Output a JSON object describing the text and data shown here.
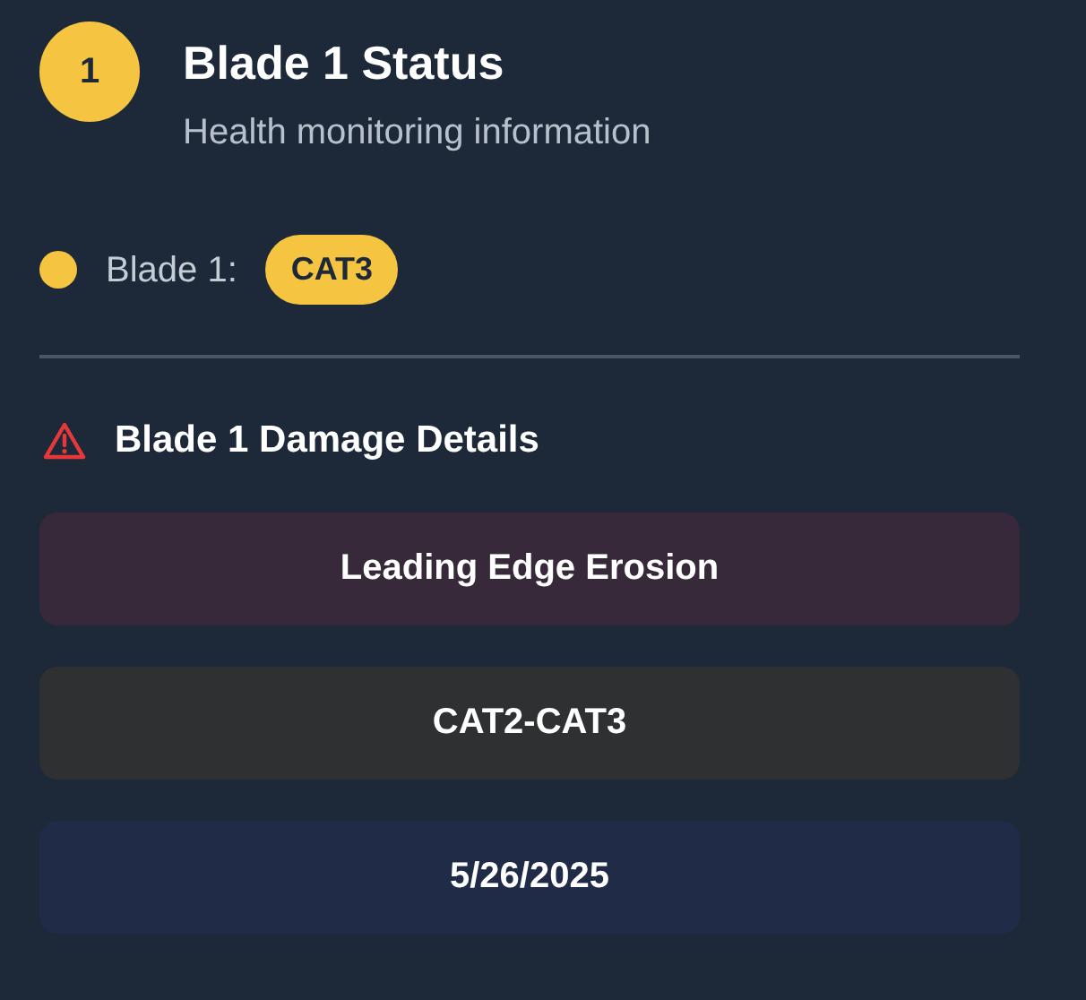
{
  "header": {
    "number": "1",
    "title": "Blade 1 Status",
    "subtitle": "Health monitoring information"
  },
  "status": {
    "label": "Blade 1:",
    "badge": "CAT3",
    "color": "#f5c542"
  },
  "damage": {
    "title": "Blade 1 Damage Details",
    "items": [
      {
        "kind": "type",
        "text": "Leading Edge Erosion"
      },
      {
        "kind": "category",
        "text": "CAT2-CAT3"
      },
      {
        "kind": "date",
        "text": "5/26/2025"
      }
    ]
  }
}
